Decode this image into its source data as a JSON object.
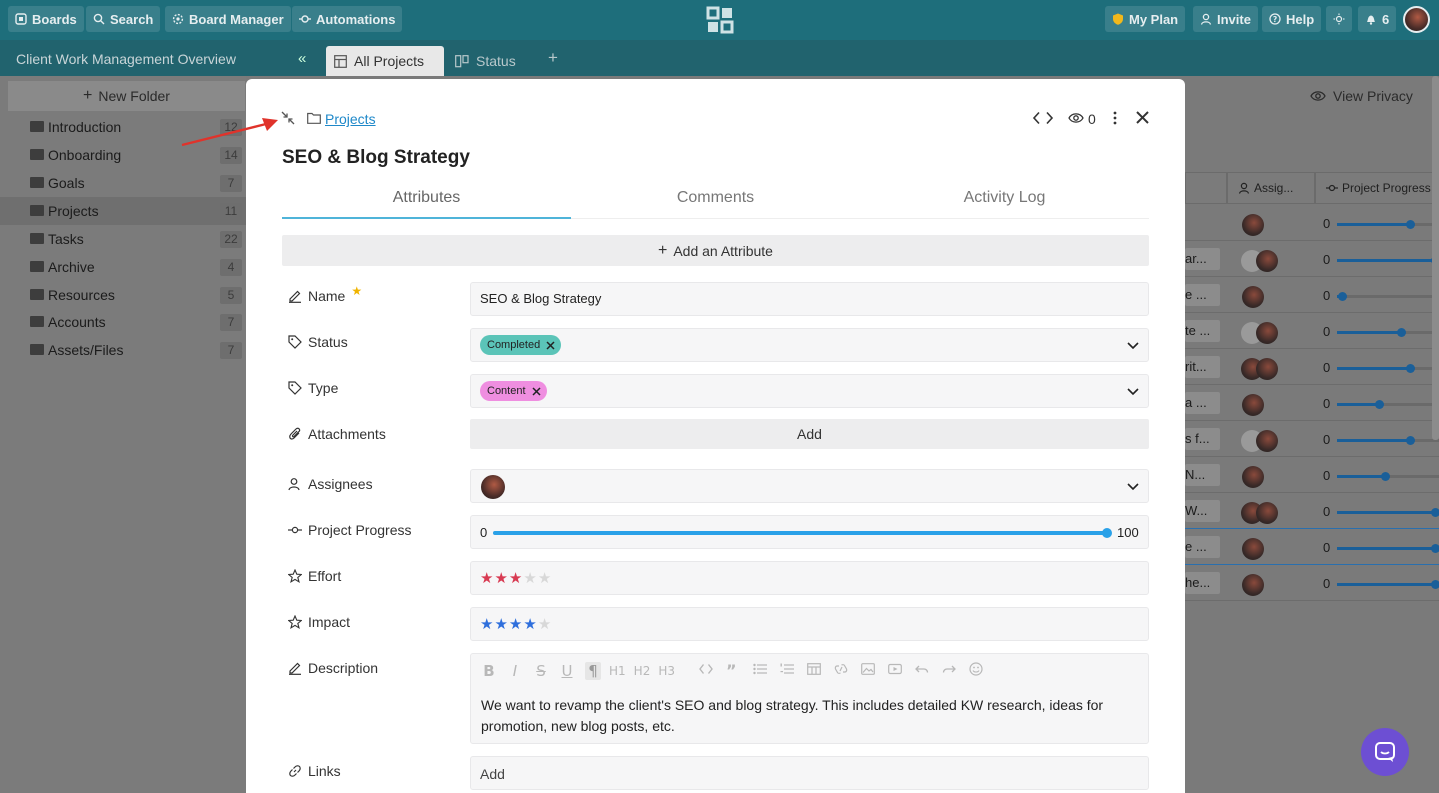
{
  "topbar": {
    "boards": "Boards",
    "search": "Search",
    "board_manager": "Board Manager",
    "automations": "Automations",
    "my_plan": "My Plan",
    "invite": "Invite",
    "help": "Help",
    "notif_count": "6"
  },
  "subbar": {
    "title": "Client Work Management Overview",
    "tabs": [
      {
        "label": "All Projects"
      },
      {
        "label": "Status"
      }
    ]
  },
  "sidebar": {
    "new_folder": "New Folder",
    "folders": [
      {
        "label": "Introduction",
        "count": "12"
      },
      {
        "label": "Onboarding",
        "count": "14"
      },
      {
        "label": "Goals",
        "count": "7"
      },
      {
        "label": "Projects",
        "count": "11"
      },
      {
        "label": "Tasks",
        "count": "22"
      },
      {
        "label": "Archive",
        "count": "4"
      },
      {
        "label": "Resources",
        "count": "5"
      },
      {
        "label": "Accounts",
        "count": "7"
      },
      {
        "label": "Assets/Files",
        "count": "7"
      }
    ]
  },
  "background_table": {
    "view_privacy": "View Privacy",
    "col_assignees": "Assig...",
    "col_progress": "Project Progress",
    "rows": [
      {
        "text": "",
        "progress": 0.72
      },
      {
        "text": "ar...",
        "progress": 0.98
      },
      {
        "text": "e ...",
        "progress": 0.05
      },
      {
        "text": "te ...",
        "progress": 0.63
      },
      {
        "text": "rit...",
        "progress": 0.72
      },
      {
        "text": "a ...",
        "progress": 0.41
      },
      {
        "text": "s f...",
        "progress": 0.72
      },
      {
        "text": "N...",
        "progress": 0.47
      },
      {
        "text": "W...",
        "progress": 1.0
      },
      {
        "text": "e ...",
        "progress": 1.0
      },
      {
        "text": "he...",
        "progress": 1.0
      }
    ],
    "zero": "0"
  },
  "modal": {
    "breadcrumb": "Projects",
    "view_count": "0",
    "title": "SEO & Blog Strategy",
    "tabs": [
      "Attributes",
      "Comments",
      "Activity Log"
    ],
    "add_attribute": "Add an Attribute",
    "fields": {
      "name_label": "Name",
      "name_value": "SEO & Blog Strategy",
      "status_label": "Status",
      "status_value": "Completed",
      "type_label": "Type",
      "type_value": "Content",
      "attachments_label": "Attachments",
      "attachments_add": "Add",
      "assignees_label": "Assignees",
      "progress_label": "Project Progress",
      "progress_min": "0",
      "progress_max": "100",
      "progress_value": 1.0,
      "effort_label": "Effort",
      "effort_rating": 3,
      "impact_label": "Impact",
      "impact_rating": 4,
      "rating_max": 5,
      "description_label": "Description",
      "description_text": "We want to revamp the client's SEO and blog strategy. This includes detailed KW research, ideas for promotion, new blog posts, etc.",
      "links_label": "Links",
      "links_add": "Add"
    },
    "toolbar": [
      "B",
      "I",
      "S",
      "U",
      "¶",
      "H1",
      "H2",
      "H3"
    ]
  },
  "colors": {
    "teal_top": "#1e6e7b",
    "status_tag": "#5bc4b8",
    "type_tag": "#ef8ee0",
    "progress": "#2aa1e8",
    "effort_star": "#d83a52",
    "impact_star": "#2f6fdc",
    "chat": "#6d4fd3"
  }
}
